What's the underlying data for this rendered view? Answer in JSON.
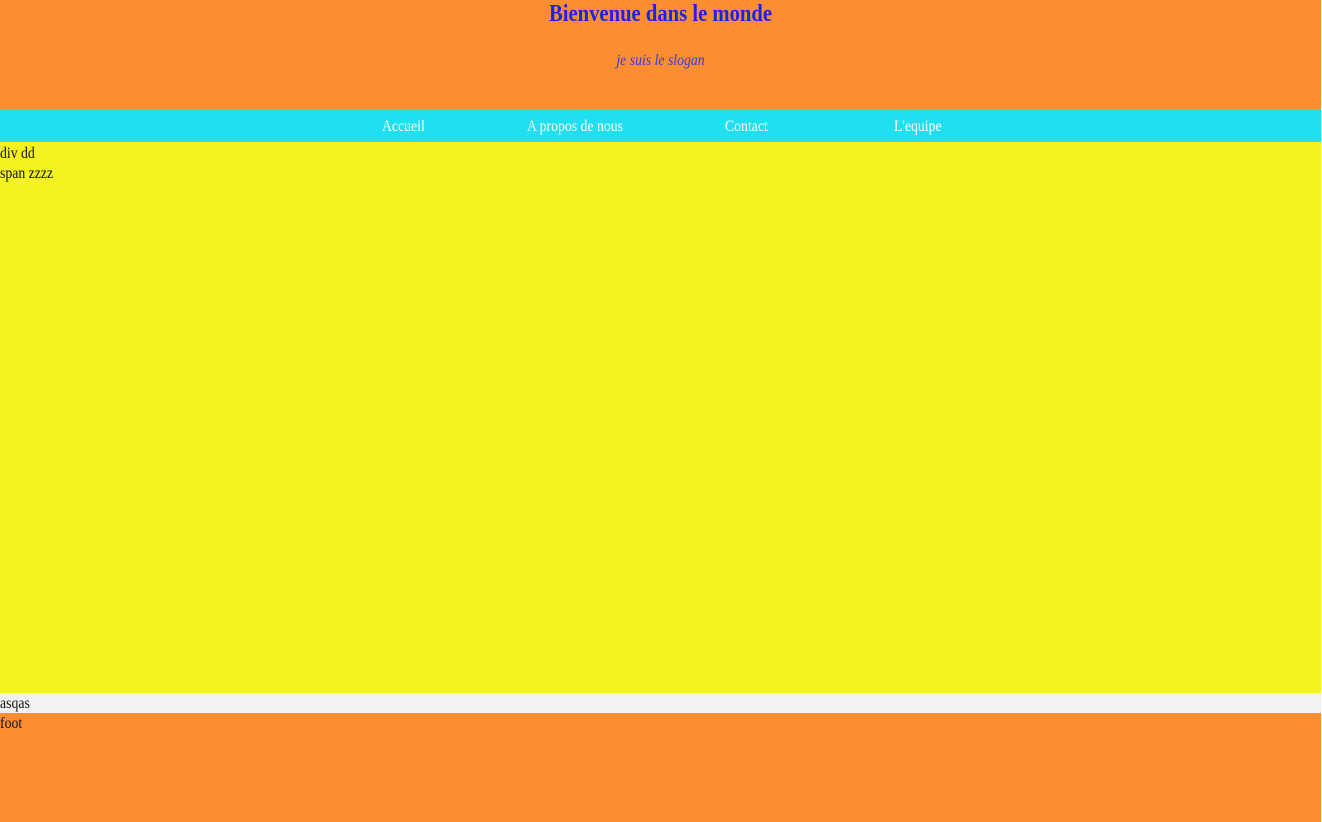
{
  "header": {
    "title": "Bienvenue dans le monde",
    "slogan": "je suis le slogan"
  },
  "nav": {
    "items": [
      {
        "label": "Accueil"
      },
      {
        "label": "A propos de nous"
      },
      {
        "label": "Contact"
      },
      {
        "label": "L'equipe"
      }
    ]
  },
  "content": {
    "div_text": "div dd",
    "span_text": "span zzzz"
  },
  "strip": {
    "text": "asqas"
  },
  "footer": {
    "text": "foot"
  },
  "colors": {
    "header_bg": "#fb8e33",
    "title": "#2020ee",
    "nav_bg": "#20dff0",
    "nav_text": "#ffffff",
    "content_bg": "#f2f320",
    "strip_bg": "#f2f2f2",
    "footer_bg": "#fb8e33"
  }
}
